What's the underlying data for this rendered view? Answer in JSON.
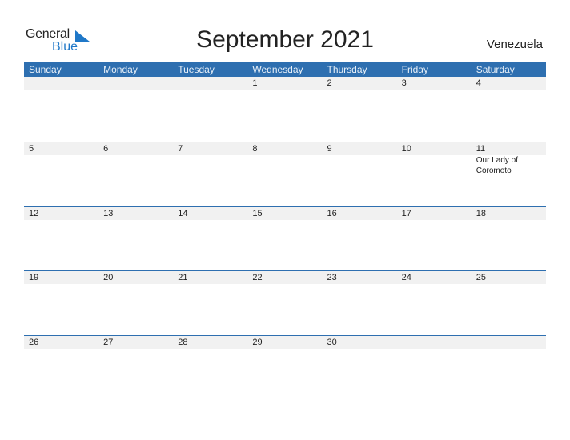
{
  "header": {
    "logo_general": "General",
    "logo_blue": "Blue",
    "title": "September 2021",
    "country": "Venezuela"
  },
  "colors": {
    "accent": "#2e6fb0",
    "logo_blue": "#1f78c8",
    "strip": "#f1f1f1"
  },
  "weekdays": [
    "Sunday",
    "Monday",
    "Tuesday",
    "Wednesday",
    "Thursday",
    "Friday",
    "Saturday"
  ],
  "weeks": [
    {
      "days": [
        "",
        "",
        "",
        "1",
        "2",
        "3",
        "4"
      ],
      "events": [
        "",
        "",
        "",
        "",
        "",
        "",
        ""
      ]
    },
    {
      "days": [
        "5",
        "6",
        "7",
        "8",
        "9",
        "10",
        "11"
      ],
      "events": [
        "",
        "",
        "",
        "",
        "",
        "",
        "Our Lady of Coromoto"
      ]
    },
    {
      "days": [
        "12",
        "13",
        "14",
        "15",
        "16",
        "17",
        "18"
      ],
      "events": [
        "",
        "",
        "",
        "",
        "",
        "",
        ""
      ]
    },
    {
      "days": [
        "19",
        "20",
        "21",
        "22",
        "23",
        "24",
        "25"
      ],
      "events": [
        "",
        "",
        "",
        "",
        "",
        "",
        ""
      ]
    },
    {
      "days": [
        "26",
        "27",
        "28",
        "29",
        "30",
        "",
        ""
      ],
      "events": [
        "",
        "",
        "",
        "",
        "",
        "",
        ""
      ]
    }
  ]
}
